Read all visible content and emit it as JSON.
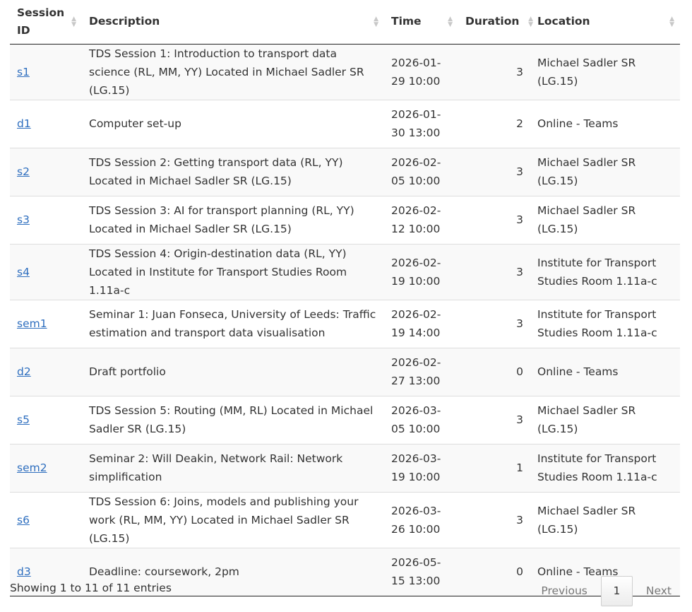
{
  "table": {
    "columns": [
      {
        "label": "Session ID"
      },
      {
        "label": "Description"
      },
      {
        "label": "Time"
      },
      {
        "label": "Duration"
      },
      {
        "label": "Location"
      }
    ],
    "rows": [
      {
        "id": "s1",
        "description": "TDS Session 1: Introduction to transport data science (RL, MM, YY) Located in Michael Sadler SR (LG.15)",
        "time": "2026-01-29 10:00",
        "duration": "3",
        "location": "Michael Sadler SR (LG.15)"
      },
      {
        "id": "d1",
        "description": "Computer set-up",
        "time": "2026-01-30 13:00",
        "duration": "2",
        "location": "Online - Teams"
      },
      {
        "id": "s2",
        "description": "TDS Session 2: Getting transport data (RL, YY) Located in Michael Sadler SR (LG.15)",
        "time": "2026-02-05 10:00",
        "duration": "3",
        "location": "Michael Sadler SR (LG.15)"
      },
      {
        "id": "s3",
        "description": "TDS Session 3: AI for transport planning (RL, YY) Located in Michael Sadler SR (LG.15)",
        "time": "2026-02-12 10:00",
        "duration": "3",
        "location": "Michael Sadler SR (LG.15)"
      },
      {
        "id": "s4",
        "description": "TDS Session 4: Origin-destination data (RL, YY) Located in Institute for Transport Studies Room 1.11a-c",
        "time": "2026-02-19 10:00",
        "duration": "3",
        "location": "Institute for Transport Studies Room 1.11a-c"
      },
      {
        "id": "sem1",
        "description": "Seminar 1: Juan Fonseca, University of Leeds: Traffic estimation and transport data visualisation",
        "time": "2026-02-19 14:00",
        "duration": "3",
        "location": "Institute for Transport Studies Room 1.11a-c"
      },
      {
        "id": "d2",
        "description": "Draft portfolio",
        "time": "2026-02-27 13:00",
        "duration": "0",
        "location": "Online - Teams"
      },
      {
        "id": "s5",
        "description": "TDS Session 5: Routing (MM, RL) Located in Michael Sadler SR (LG.15)",
        "time": "2026-03-05 10:00",
        "duration": "3",
        "location": "Michael Sadler SR (LG.15)"
      },
      {
        "id": "sem2",
        "description": "Seminar 2: Will Deakin, Network Rail: Network simplification",
        "time": "2026-03-19 10:00",
        "duration": "1",
        "location": "Institute for Transport Studies Room 1.11a-c"
      },
      {
        "id": "s6",
        "description": "TDS Session 6: Joins, models and publishing your work (RL, MM, YY) Located in Michael Sadler SR (LG.15)",
        "time": "2026-03-26 10:00",
        "duration": "3",
        "location": "Michael Sadler SR (LG.15)"
      },
      {
        "id": "d3",
        "description": "Deadline: coursework, 2pm",
        "time": "2026-05-15 13:00",
        "duration": "0",
        "location": "Online - Teams"
      }
    ]
  },
  "footer": {
    "info": "Showing 1 to 11 of 11 entries",
    "previous": "Previous",
    "page": "1",
    "next": "Next"
  },
  "colors": {
    "link": "#2f6fbf",
    "stripe": "#f9f9f9"
  }
}
